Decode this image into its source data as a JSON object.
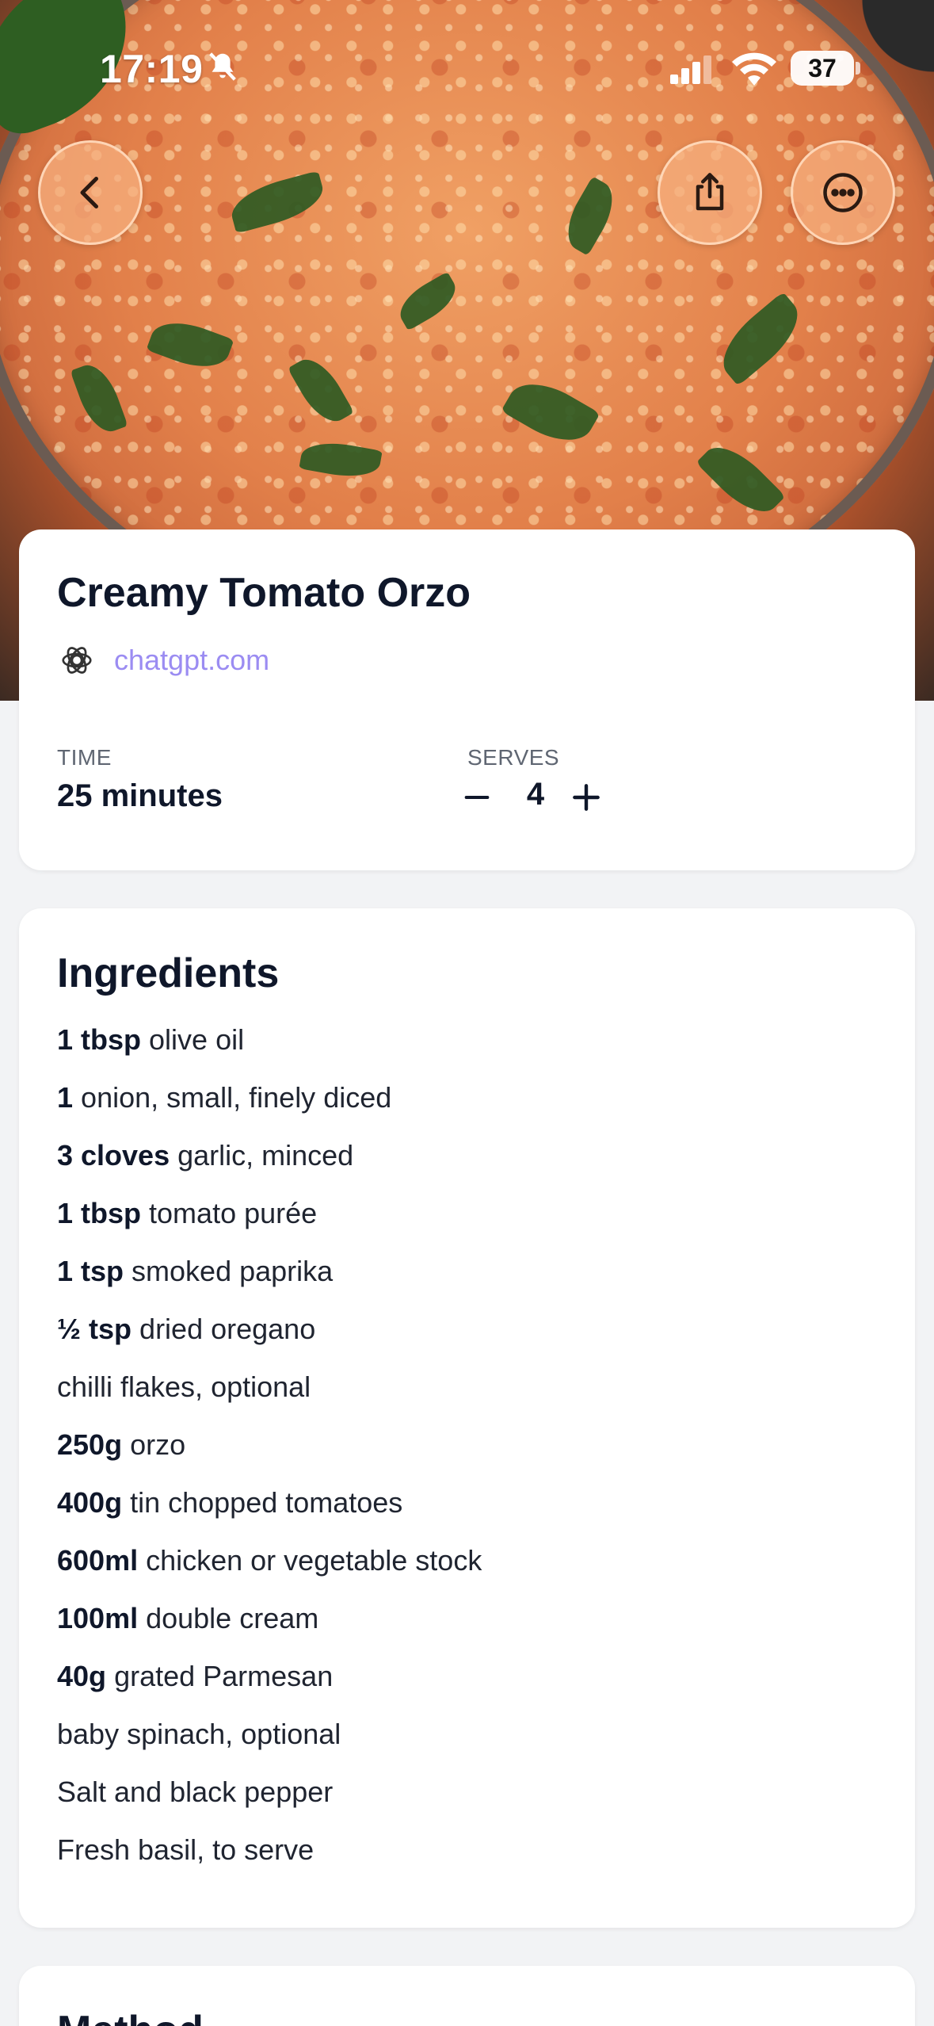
{
  "status_bar": {
    "time": "17:19",
    "battery": "37",
    "icons": [
      "bell-slash-icon",
      "cellular-signal-icon",
      "wifi-icon",
      "battery-icon"
    ]
  },
  "hero": {
    "image": "creamy-tomato-orzo-photo",
    "buttons": [
      "back-icon",
      "share-icon",
      "more-icon"
    ]
  },
  "recipe": {
    "title": "Creamy Tomato Orzo",
    "source": "chatgpt.com",
    "source_icon": "openai-icon",
    "time_label": "TIME",
    "time_value": "25 minutes",
    "serves_label": "SERVES",
    "serves_count": "4"
  },
  "ingredients": {
    "title": "Ingredients",
    "items": [
      {
        "qty": "1 tbsp",
        "text": "olive oil"
      },
      {
        "qty": "1",
        "text": "onion, small, finely diced"
      },
      {
        "qty": "3 cloves",
        "text": "garlic, minced"
      },
      {
        "qty": "1 tbsp",
        "text": "tomato purée"
      },
      {
        "qty": "1 tsp",
        "text": "smoked paprika"
      },
      {
        "qty": "½ tsp",
        "text": "dried oregano"
      },
      {
        "qty": "",
        "text": "chilli flakes, optional"
      },
      {
        "qty": "250g",
        "text": "orzo"
      },
      {
        "qty": "400g",
        "text": "tin chopped tomatoes"
      },
      {
        "qty": "600ml",
        "text": "chicken or vegetable stock"
      },
      {
        "qty": "100ml",
        "text": "double cream"
      },
      {
        "qty": "40g",
        "text": "grated Parmesan"
      },
      {
        "qty": "",
        "text": "baby spinach, optional"
      },
      {
        "qty": "",
        "text": "Salt and black pepper"
      },
      {
        "qty": "",
        "text": "Fresh basil, to serve"
      }
    ]
  },
  "method": {
    "title": "Method"
  },
  "colors": {
    "accent_link": "#9b8cf2",
    "background": "#f2f3f5",
    "button_glass": "#f7b080"
  }
}
